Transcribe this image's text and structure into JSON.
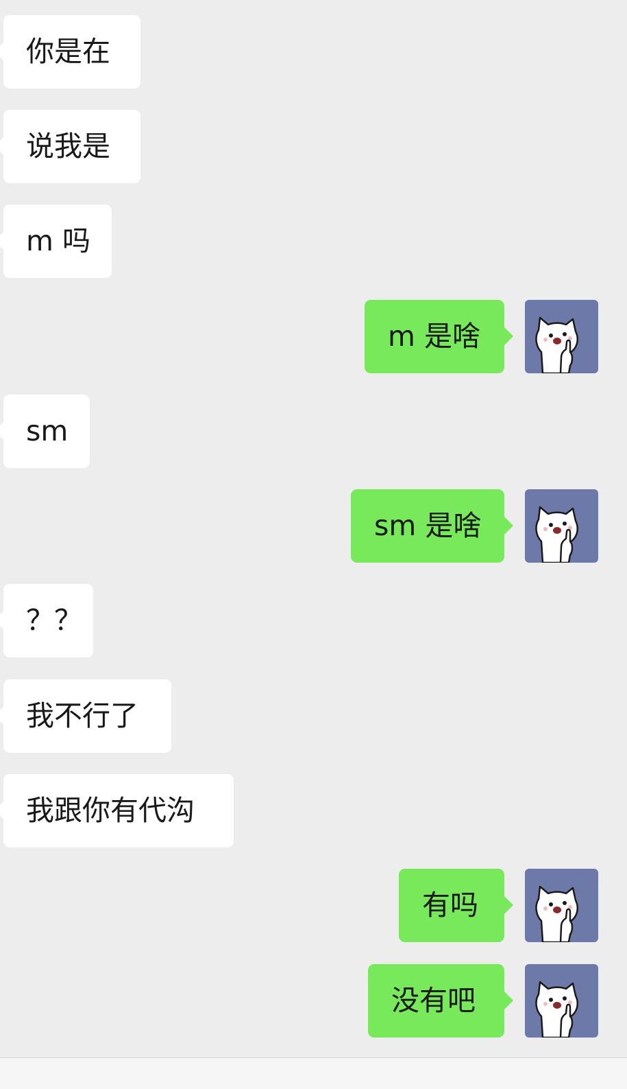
{
  "messages": [
    {
      "side": "left",
      "text": "你是在"
    },
    {
      "side": "left",
      "text": "说我是"
    },
    {
      "side": "left",
      "text": "m 吗"
    },
    {
      "side": "right",
      "text": "m 是啥",
      "avatar": "cat-avatar-icon"
    },
    {
      "side": "left",
      "text": "sm"
    },
    {
      "side": "right",
      "text": "sm 是啥",
      "avatar": "cat-avatar-icon"
    },
    {
      "side": "left",
      "text": "？？"
    },
    {
      "side": "left",
      "text": "我不行了"
    },
    {
      "side": "left",
      "text": "我跟你有代沟"
    },
    {
      "side": "right",
      "text": "有吗",
      "avatar": "cat-avatar-icon"
    },
    {
      "side": "right",
      "text": "没有吧",
      "avatar": "cat-avatar-icon"
    }
  ],
  "colors": {
    "background": "#ededed",
    "incoming_bubble": "#ffffff",
    "outgoing_bubble": "#77e95a",
    "avatar_background": "#6d7aa9",
    "text": "#191919"
  }
}
